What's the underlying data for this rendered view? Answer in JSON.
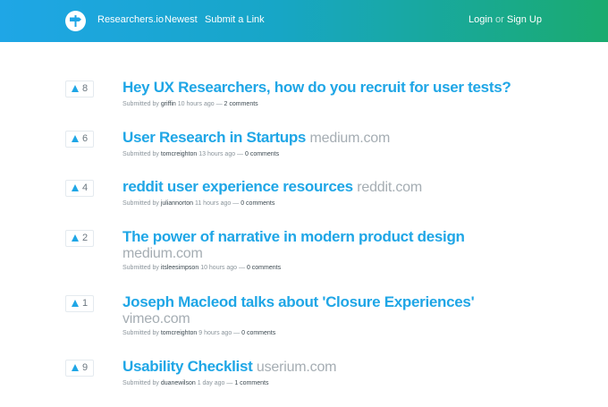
{
  "nav": {
    "brand": "Researchers.io",
    "newest": "Newest",
    "submit": "Submit a Link",
    "login": "Login",
    "or": "or",
    "signup": "Sign Up"
  },
  "colors": {
    "accent": "#1fa6e6",
    "gradient_start": "#1fa6e6",
    "gradient_end": "#1aab6f"
  },
  "posts": [
    {
      "votes": "8",
      "title": "Hey UX Researchers, how do you recruit for user tests?",
      "domain": "",
      "submitted": "Submitted by",
      "author": "griffin",
      "time": "10 hours ago —",
      "comments": "2 comments"
    },
    {
      "votes": "6",
      "title": "User Research in Startups",
      "domain": "medium.com",
      "submitted": "Submitted by",
      "author": "tomcreighton",
      "time": "13 hours ago —",
      "comments": "0 comments"
    },
    {
      "votes": "4",
      "title": "reddit user experience resources",
      "domain": "reddit.com",
      "submitted": "Submitted by",
      "author": "juliannorton",
      "time": "11 hours ago —",
      "comments": "0 comments"
    },
    {
      "votes": "2",
      "title": "The power of narrative in modern product design",
      "domain": "medium.com",
      "submitted": "Submitted by",
      "author": "itsleesimpson",
      "time": "10 hours ago —",
      "comments": "0 comments"
    },
    {
      "votes": "1",
      "title": "Joseph Macleod talks about 'Closure Experiences'",
      "domain": "vimeo.com",
      "submitted": "Submitted by",
      "author": "tomcreighton",
      "time": "9 hours ago —",
      "comments": "0 comments"
    },
    {
      "votes": "9",
      "title": "Usability Checklist",
      "domain": "userium.com",
      "submitted": "Submitted by",
      "author": "duanewilson",
      "time": "1 day ago —",
      "comments": "1 comments"
    }
  ]
}
